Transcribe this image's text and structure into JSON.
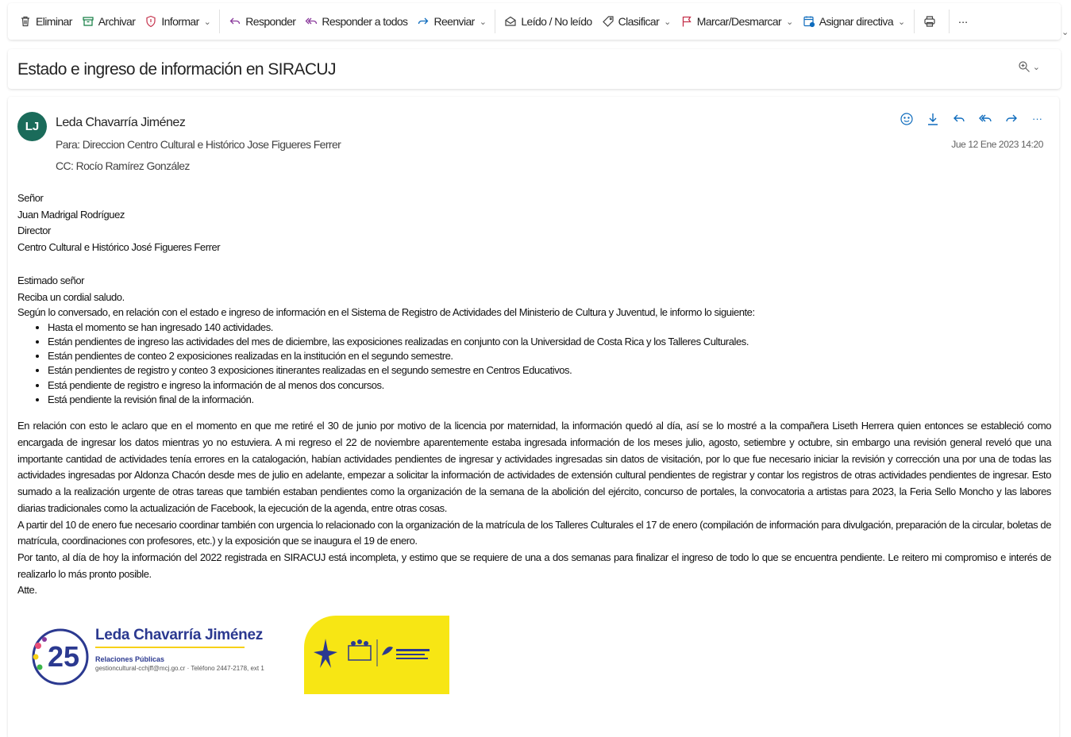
{
  "toolbar": {
    "delete": "Eliminar",
    "archive": "Archivar",
    "report": "Informar",
    "reply": "Responder",
    "reply_all": "Responder a todos",
    "forward": "Reenviar",
    "read_unread": "Leído / No leído",
    "categorize": "Clasificar",
    "flag": "Marcar/Desmarcar",
    "policy": "Asignar directiva",
    "more": "···"
  },
  "subject": "Estado e ingreso de información en SIRACUJ",
  "message": {
    "avatar_initials": "LJ",
    "avatar_color": "#1a6b5a",
    "sender": "Leda Chavarría Jiménez",
    "to_label": "Para:",
    "to": "Direccion Centro Cultural e Histórico Jose Figueres Ferrer",
    "cc_label": "CC:",
    "cc": "Rocío Ramírez González",
    "date": "Jue 12 Ene 2023 14:20",
    "more": "···"
  },
  "body": {
    "address": [
      "Señor",
      "Juan Madrigal Rodríguez",
      "Director",
      "Centro Cultural e Histórico José Figueres Ferrer"
    ],
    "greeting": "Estimado señor",
    "salute": "Reciba un cordial saludo.",
    "intro": "Según lo conversado, en relación con el estado e ingreso de información en el Sistema de Registro de Actividades del Ministerio de Cultura y Juventud, le informo lo siguiente:",
    "bullets": [
      "Hasta el momento se han ingresado 140 actividades.",
      "Están pendientes de ingreso las actividades del mes de diciembre, las exposiciones realizadas en conjunto con la Universidad de Costa Rica y los Talleres Culturales.",
      "Están pendientes de conteo 2 exposiciones realizadas en la institución en el segundo semestre.",
      "Están pendientes de registro y conteo 3 exposiciones itinerantes realizadas en el segundo semestre en Centros Educativos.",
      "Está pendiente de registro e ingreso la información de al menos dos concursos.",
      "Está pendiente la revisión final de la información."
    ],
    "paragraph1": "En relación con esto le aclaro que en el momento en que me retiré el 30 de junio por motivo de la licencia por maternidad, la información quedó al día, así se lo mostré a la compañera Liseth Herrera quien entonces se estableció como encargada de ingresar los datos mientras yo no estuviera. A mi regreso el 22 de noviembre aparentemente estaba ingresada información de los meses julio, agosto, setiembre y octubre, sin embargo una revisión general reveló que una importante cantidad de actividades tenía errores en la catalogación,  habían actividades pendientes de ingresar y actividades ingresadas sin datos de visitación, por lo que fue necesario iniciar la revisión y corrección una por una de todas las actividades ingresadas por Aldonza Chacón desde mes de julio en adelante, empezar a solicitar la información de actividades de extensión cultural pendientes de registrar y contar los registros de otras actividades pendientes de ingresar. Esto sumado a la realización urgente de otras tareas que también estaban pendientes como la organización de la semana de la abolición del ejército, concurso de portales, la convocatoria a artistas para 2023, la Feria Sello Moncho y las labores diarias tradicionales como la actualización de Facebook, la ejecución de la agenda,  entre otras cosas.",
    "paragraph2": "A partir del 10 de enero fue necesario coordinar también con urgencia lo relacionado con la organización de la matrícula de los Talleres Culturales el 17 de enero (compilación de información para divulgación, preparación de la circular, boletas de matrícula, coordinaciones con profesores, etc.)  y la exposición que se inaugura el 19 de enero.",
    "paragraph3": "Por tanto, al día de hoy la información del 2022 registrada en SIRACUJ está incompleta, y estimo que se requiere de una a dos semanas para finalizar el ingreso de todo lo que se encuentra pendiente. Le reitero mi compromiso e interés de realizarlo lo más pronto posible.",
    "closing": "Atte."
  },
  "signature": {
    "name": "Leda Chavarría Jiménez",
    "role": "Relaciones Públicas",
    "contact": "gestioncultural-cchjff@mcj.go.cr · Teléfono 2447-2178, ext 1",
    "logo_text": "25",
    "accent_color": "#f7e614",
    "name_color": "#2b3990"
  }
}
